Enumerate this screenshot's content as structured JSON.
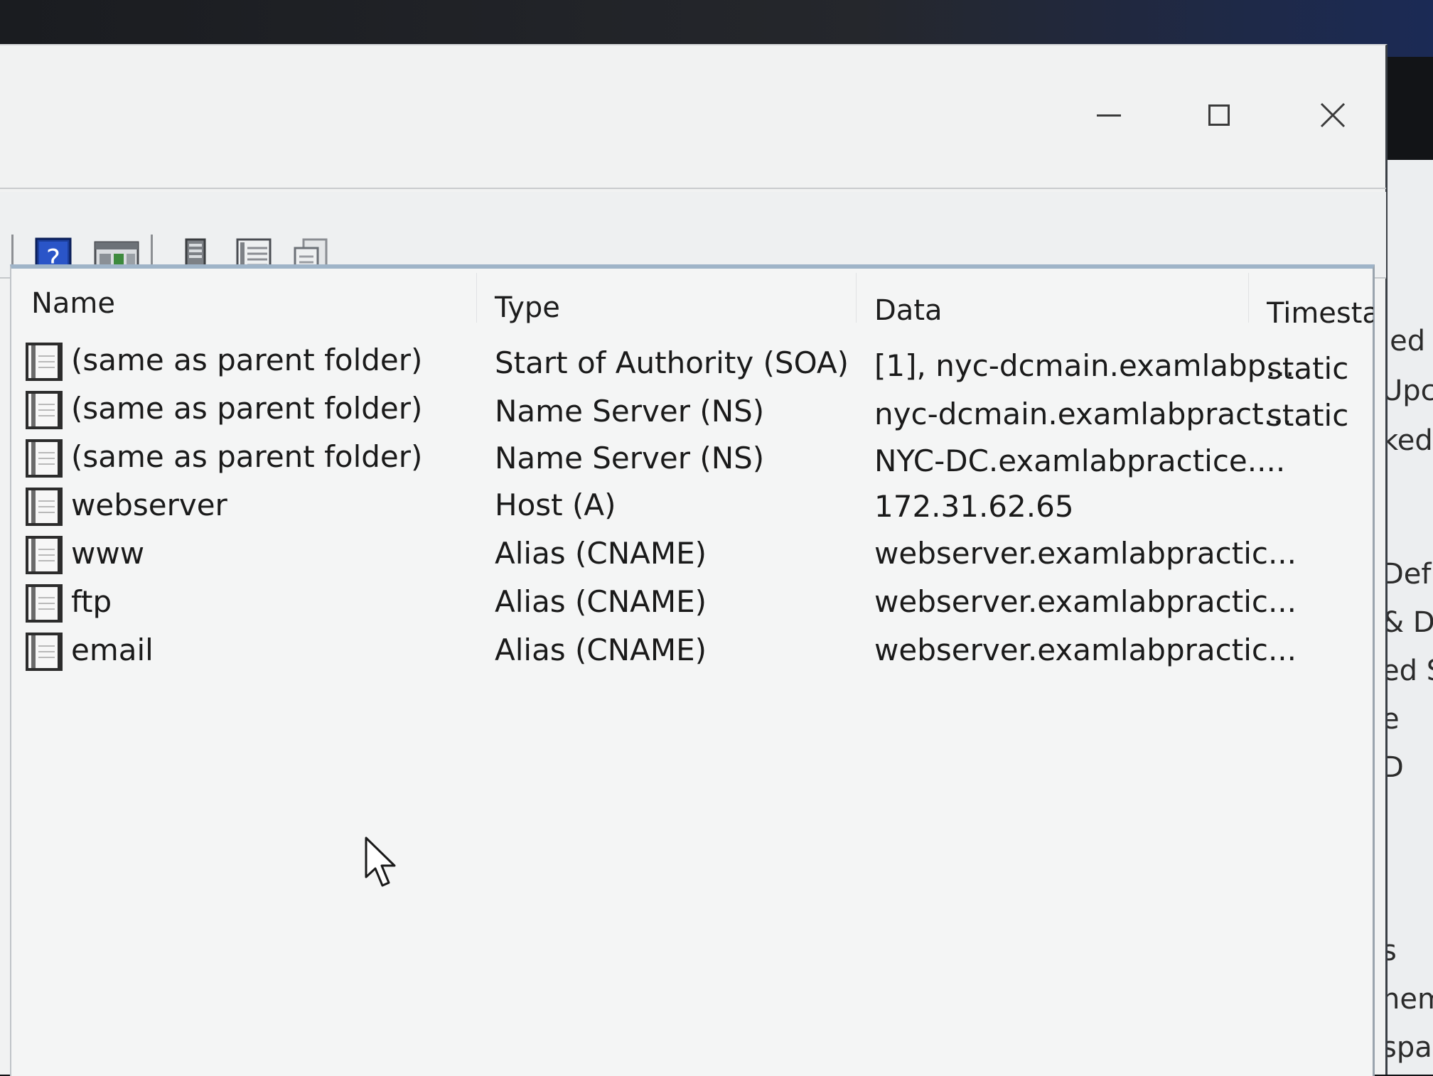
{
  "window_controls": {
    "minimize": "minimize",
    "maximize": "maximize",
    "close": "close"
  },
  "toolbar": {
    "buttons": [
      "help-icon",
      "show-hide-console-tree-icon",
      "server-icon",
      "list-icon",
      "properties-icon"
    ]
  },
  "table": {
    "columns": [
      "Name",
      "Type",
      "Data",
      "Timestar"
    ],
    "rows": [
      {
        "name": "(same as parent folder)",
        "type": "Start of Authority (SOA)",
        "data": "[1], nyc-dcmain.examlabp...",
        "timestamp": "static"
      },
      {
        "name": "(same as parent folder)",
        "type": "Name Server (NS)",
        "data": "nyc-dcmain.examlabpract...",
        "timestamp": "static"
      },
      {
        "name": "(same as parent folder)",
        "type": "Name Server (NS)",
        "data": "NYC-DC.examlabpractice....",
        "timestamp": ""
      },
      {
        "name": "webserver",
        "type": "Host (A)",
        "data": "172.31.62.65",
        "timestamp": ""
      },
      {
        "name": "www",
        "type": "Alias (CNAME)",
        "data": "webserver.examlabpractic...",
        "timestamp": ""
      },
      {
        "name": "ftp",
        "type": "Alias (CNAME)",
        "data": "webserver.examlabpractic...",
        "timestamp": ""
      },
      {
        "name": "email",
        "type": "Alias (CNAME)",
        "data": "webserver.examlabpractic...",
        "timestamp": ""
      }
    ]
  },
  "background_window": {
    "fragments": [
      "led",
      "Upc",
      "ked",
      "Def",
      "& D",
      "ed S",
      "e",
      "D",
      "s",
      "nem",
      "spac"
    ]
  }
}
